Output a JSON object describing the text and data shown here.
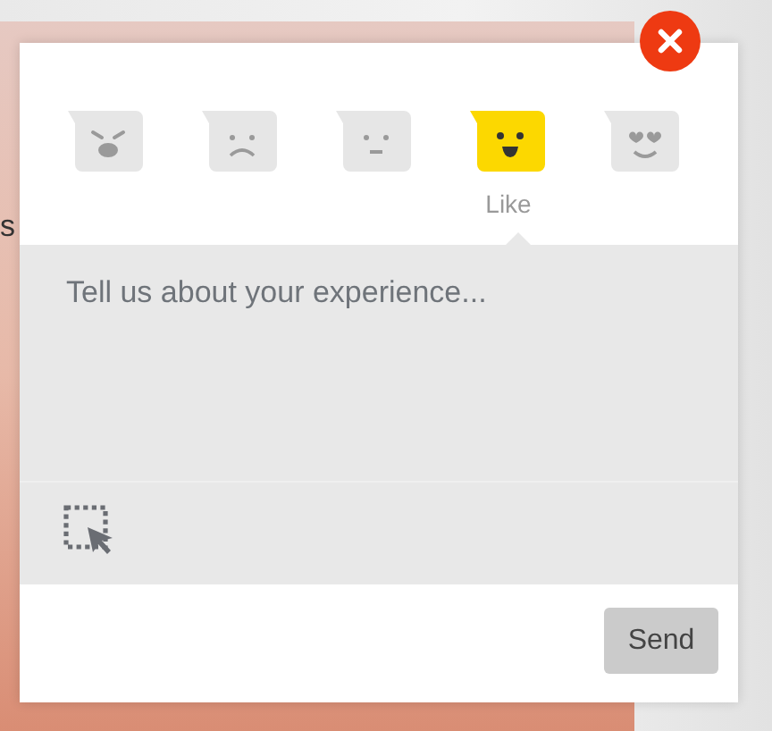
{
  "background_text": "s",
  "reactions": [
    {
      "kind": "angry",
      "selected": false
    },
    {
      "kind": "sad",
      "selected": false
    },
    {
      "kind": "neutral",
      "selected": false
    },
    {
      "kind": "happy",
      "selected": true,
      "label": "Like"
    },
    {
      "kind": "love",
      "selected": false
    }
  ],
  "feedback": {
    "placeholder": "Tell us about your experience..."
  },
  "buttons": [
    {
      "label": "Send"
    }
  ]
}
